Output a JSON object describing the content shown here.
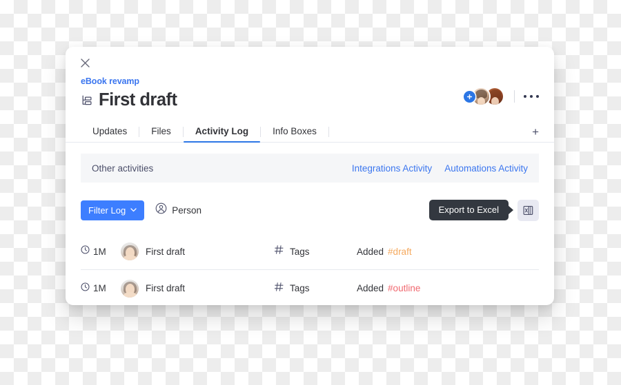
{
  "card": {
    "close_icon": "close-icon",
    "breadcrumb": "eBook revamp",
    "title": "First draft",
    "title_icon": "subitem-icon"
  },
  "people": {
    "add_person_icon": "add-person-icon",
    "avatars": [
      "avatar-1",
      "avatar-2"
    ],
    "more_menu_icon": "more-options-icon"
  },
  "tabs": {
    "items": [
      {
        "label": "Updates",
        "active": false
      },
      {
        "label": "Files",
        "active": false
      },
      {
        "label": "Activity Log",
        "active": true
      },
      {
        "label": "Info Boxes",
        "active": false
      }
    ],
    "add_label": "+",
    "active_underline_color": "#2b76e5"
  },
  "other_activities": {
    "label": "Other activities",
    "links": [
      "Integrations Activity",
      "Automations Activity"
    ],
    "background": "#f5f6f8",
    "link_color": "#3b76ef"
  },
  "filter_bar": {
    "filter_button_label": "Filter Log",
    "filter_button_color": "#3d7eff",
    "chevron_icon": "chevron-down-icon",
    "person_icon": "person-circle-icon",
    "person_label": "Person",
    "tooltip_text": "Export to Excel",
    "tooltip_color": "#333840",
    "export_icon": "excel-file-icon"
  },
  "activity_rows": [
    {
      "time_icon": "clock-icon",
      "time": "1M",
      "avatar": "avatar-person",
      "item": "First draft",
      "column_icon": "hash-icon",
      "column": "Tags",
      "action": "Added",
      "tag": "#draft",
      "tag_color": "#f5a95e"
    },
    {
      "time_icon": "clock-icon",
      "time": "1M",
      "avatar": "avatar-person",
      "item": "First draft",
      "column_icon": "hash-icon",
      "column": "Tags",
      "action": "Added",
      "tag": "#outline",
      "tag_color": "#f0686f"
    }
  ]
}
